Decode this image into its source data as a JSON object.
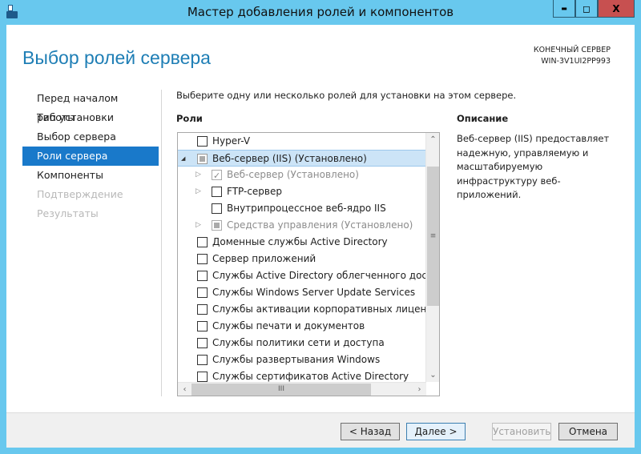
{
  "window": {
    "title": "Мастер добавления ролей и компонентов",
    "minimize": "▬",
    "maximize": "◻",
    "close": "X",
    "close_color": "#c75050",
    "frame_color": "#68c8ee"
  },
  "header": {
    "page_title": "Выбор ролей сервера",
    "target_label": "КОНЕЧНЫЙ СЕРВЕР",
    "target_name": "WIN-3V1UI2PP993"
  },
  "nav": [
    {
      "label": "Перед началом работы",
      "state": "normal"
    },
    {
      "label": "Тип установки",
      "state": "normal"
    },
    {
      "label": "Выбор сервера",
      "state": "normal"
    },
    {
      "label": "Роли сервера",
      "state": "selected"
    },
    {
      "label": "Компоненты",
      "state": "normal"
    },
    {
      "label": "Подтверждение",
      "state": "disabled"
    },
    {
      "label": "Результаты",
      "state": "disabled"
    }
  ],
  "main": {
    "intro": "Выберите одну или несколько ролей для установки на этом сервере.",
    "roles_label": "Роли",
    "description_label": "Описание",
    "description": "Веб-сервер (IIS) предоставляет надежную, управляемую и масштабируемую инфраструктуру веб-приложений."
  },
  "roles": [
    {
      "label": "Hyper-V",
      "level": 0,
      "check": "none",
      "expander": "",
      "gray": false
    },
    {
      "label": "Веб-сервер (IIS) (Установлено)",
      "level": 0,
      "check": "partial",
      "expander": "expanded",
      "gray": false,
      "selected": true
    },
    {
      "label": "Веб-сервер (Установлено)",
      "level": 1,
      "check": "checked",
      "expander": "collapsed",
      "gray": true
    },
    {
      "label": "FTP-сервер",
      "level": 1,
      "check": "none",
      "expander": "collapsed",
      "gray": false
    },
    {
      "label": "Внутрипроцессное веб-ядро IIS",
      "level": 1,
      "check": "none",
      "expander": "",
      "gray": false
    },
    {
      "label": "Средства управления (Установлено)",
      "level": 1,
      "check": "partial",
      "expander": "collapsed",
      "gray": true
    },
    {
      "label": "Доменные службы Active Directory",
      "level": 0,
      "check": "none",
      "expander": "",
      "gray": false
    },
    {
      "label": "Сервер приложений",
      "level": 0,
      "check": "none",
      "expander": "",
      "gray": false
    },
    {
      "label": "Службы Active Directory облегченного доступа к",
      "level": 0,
      "check": "none",
      "expander": "",
      "gray": false
    },
    {
      "label": "Службы Windows Server Update Services",
      "level": 0,
      "check": "none",
      "expander": "",
      "gray": false
    },
    {
      "label": "Службы активации корпоративных лицензий",
      "level": 0,
      "check": "none",
      "expander": "",
      "gray": false
    },
    {
      "label": "Службы печати и документов",
      "level": 0,
      "check": "none",
      "expander": "",
      "gray": false
    },
    {
      "label": "Службы политики сети и доступа",
      "level": 0,
      "check": "none",
      "expander": "",
      "gray": false
    },
    {
      "label": "Службы развертывания Windows",
      "level": 0,
      "check": "none",
      "expander": "",
      "gray": false
    },
    {
      "label": "Службы сертификатов Active Directory",
      "level": 0,
      "check": "none",
      "expander": "",
      "gray": false
    }
  ],
  "footer": {
    "back": "< Назад",
    "next": "Далее >",
    "install": "Установить",
    "cancel": "Отмена"
  },
  "colors": {
    "accent": "#1979ca",
    "title": "#1e7eb5"
  }
}
